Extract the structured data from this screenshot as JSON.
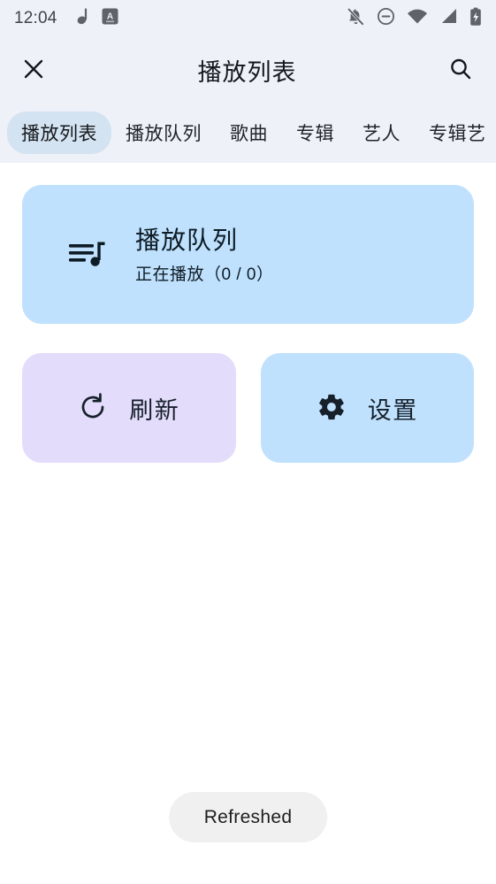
{
  "status_bar": {
    "clock": "12:04",
    "left_icons": [
      "music-note-icon",
      "app-badge-a-icon"
    ],
    "right_icons": [
      "notifications-off-icon",
      "do-not-disturb-icon",
      "wifi-icon",
      "cell-signal-icon",
      "battery-charging-icon"
    ]
  },
  "app_bar": {
    "close_icon": "close-icon",
    "title": "播放列表",
    "search_icon": "search-icon"
  },
  "tabs": {
    "active_index": 0,
    "items": [
      {
        "label": "播放列表"
      },
      {
        "label": "播放队列"
      },
      {
        "label": "歌曲"
      },
      {
        "label": "专辑"
      },
      {
        "label": "艺人"
      },
      {
        "label": "专辑艺"
      }
    ]
  },
  "queue_card": {
    "icon": "playlist-music-icon",
    "title": "播放队列",
    "subtitle": "正在播放（0 / 0）",
    "background": "#bfe1fd"
  },
  "actions": {
    "refresh": {
      "label": "刷新",
      "icon": "refresh-icon",
      "background": "#e3dcfb"
    },
    "settings": {
      "label": "设置",
      "icon": "gear-icon",
      "background": "#bfe1fd"
    }
  },
  "toast": {
    "message": "Refreshed",
    "background": "#f0f0f0"
  },
  "theme": {
    "chrome_background": "#eef1f7",
    "page_background": "#ffffff",
    "active_tab_background": "#d4e3f1",
    "text_primary": "#14181c"
  }
}
